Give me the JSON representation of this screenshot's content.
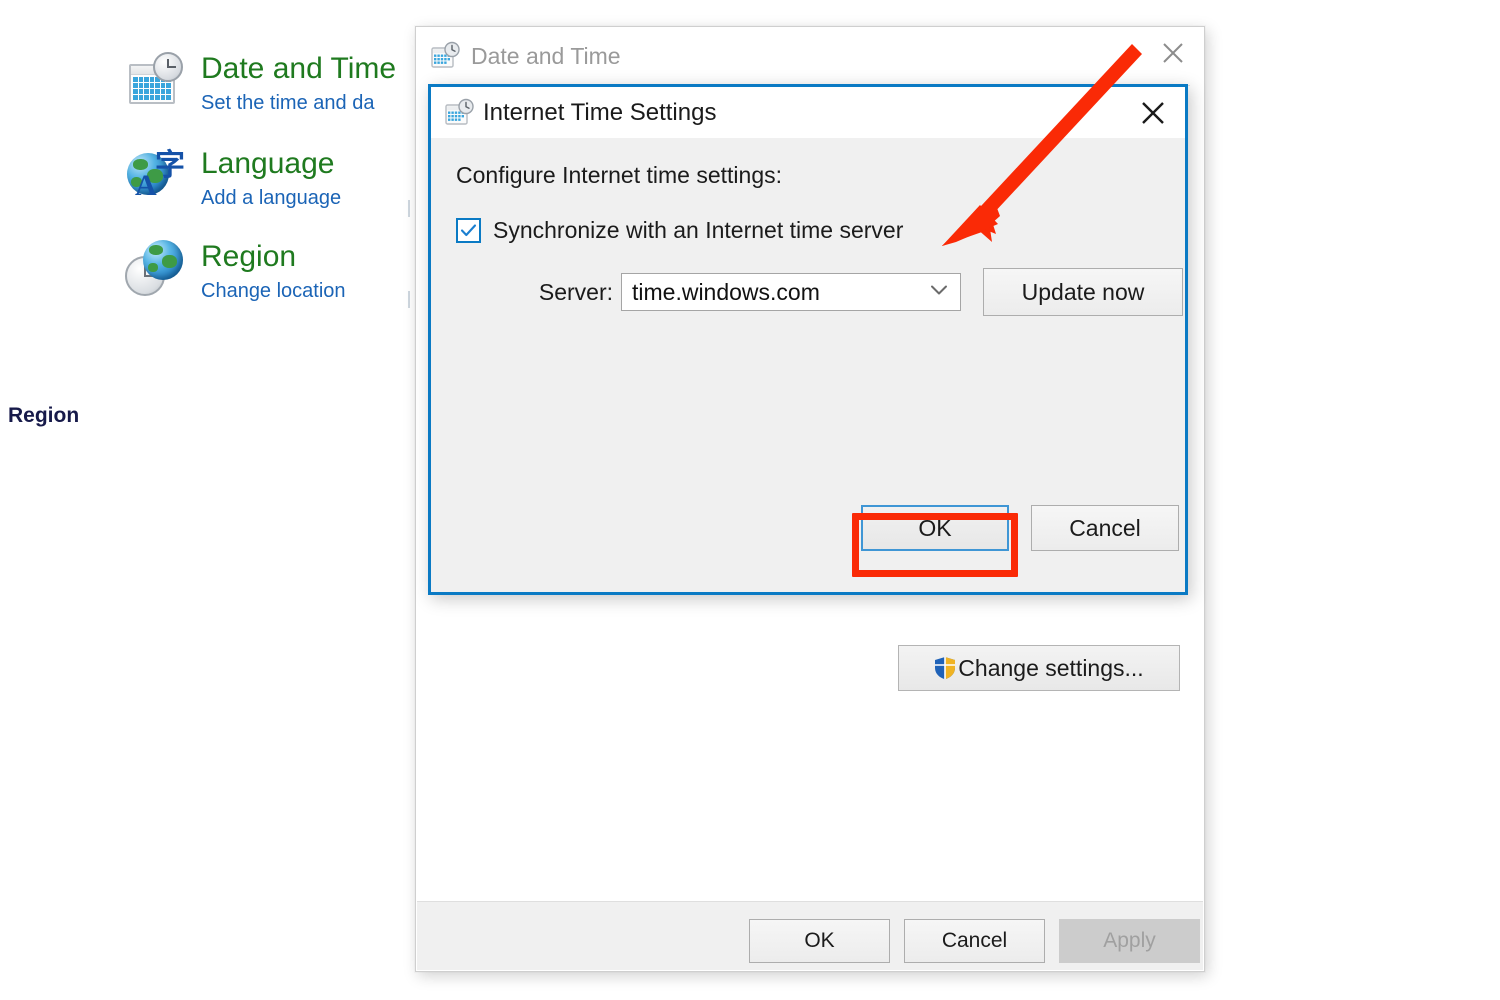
{
  "accent_colors": {
    "dialog_focus_border": "#0a7ac4",
    "annotation_red": "#fa2a06",
    "link_blue": "#1b64b6",
    "heading_green": "#1f7a1f",
    "region_heading_navy": "#171a4a"
  },
  "control_panel": {
    "region_heading": "Region",
    "items": [
      {
        "title": "Date and Time",
        "subtitle": "Set the time and da",
        "icon": "calendar-clock-icon"
      },
      {
        "title": "Language",
        "subtitle": "Add a language",
        "icon": "globe-language-icon"
      },
      {
        "title": "Region",
        "subtitle": "Change location",
        "icon": "globe-clock-icon"
      }
    ]
  },
  "date_time_dialog": {
    "title": "Date and Time",
    "title_icon": "calendar-clock-icon",
    "close_icon": "close-icon",
    "change_settings_label": "Change settings...",
    "change_settings_icon": "uac-shield-icon",
    "footer": {
      "ok_label": "OK",
      "cancel_label": "Cancel",
      "apply_label": "Apply",
      "apply_disabled": true
    }
  },
  "internet_time_dialog": {
    "title": "Internet Time Settings",
    "title_icon": "calendar-clock-icon",
    "close_icon": "close-icon",
    "configure_label": "Configure Internet time settings:",
    "sync_checkbox": {
      "label": "Synchronize with an Internet time server",
      "checked": true,
      "check_icon": "checkmark-icon"
    },
    "server": {
      "label": "Server:",
      "value": "time.windows.com",
      "placeholder": "time.windows.com",
      "chevron_icon": "chevron-down-icon"
    },
    "update_now_label": "Update now",
    "ok_label": "OK",
    "cancel_label": "Cancel"
  },
  "annotations": {
    "arrow": {
      "name": "red-arrow-annotation",
      "points_to": "Synchronize with an Internet time server"
    },
    "highlight": {
      "name": "red-highlight-box",
      "targets": "OK"
    }
  }
}
